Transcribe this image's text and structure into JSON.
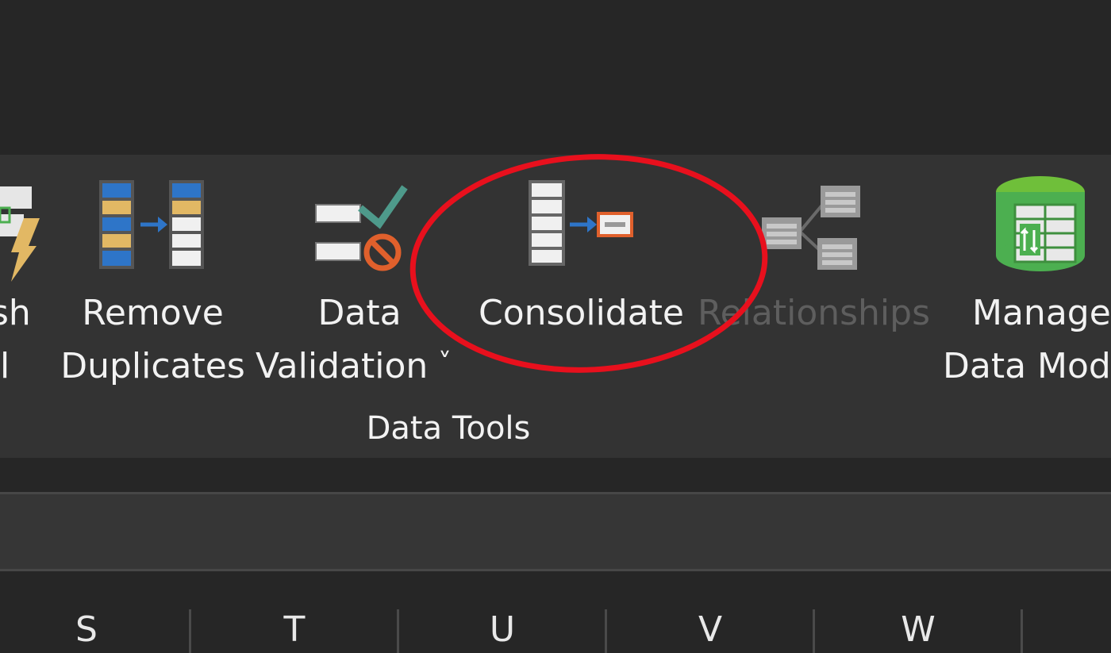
{
  "ribbon": {
    "group_label": "Data Tools",
    "buttons": {
      "flash_fill": {
        "line1": "sh",
        "line2": "l",
        "icon": "flash-fill-icon"
      },
      "remove_duplicates": {
        "line1": "Remove",
        "line2": "Duplicates",
        "icon": "remove-duplicates-icon"
      },
      "data_validation": {
        "line1": "Data",
        "line2": "Validation",
        "dropdown": "˅",
        "icon": "data-validation-icon"
      },
      "consolidate": {
        "label": "Consolidate",
        "icon": "consolidate-icon"
      },
      "relationships": {
        "label": "Relationships",
        "icon": "relationships-icon",
        "state": "disabled"
      },
      "manage_data_model": {
        "line1": "Manage",
        "line2": "Data Mod",
        "icon": "manage-data-model-icon"
      }
    }
  },
  "grid": {
    "columns": [
      "S",
      "T",
      "U",
      "V",
      "W"
    ]
  },
  "colors": {
    "highlight": "#e8101d",
    "ribbon_bg": "#333333",
    "blue": "#2e75c8",
    "gold": "#e2b864",
    "green": "#4caf50",
    "orange": "#e0602c",
    "teal_check": "#4e9a8b"
  }
}
